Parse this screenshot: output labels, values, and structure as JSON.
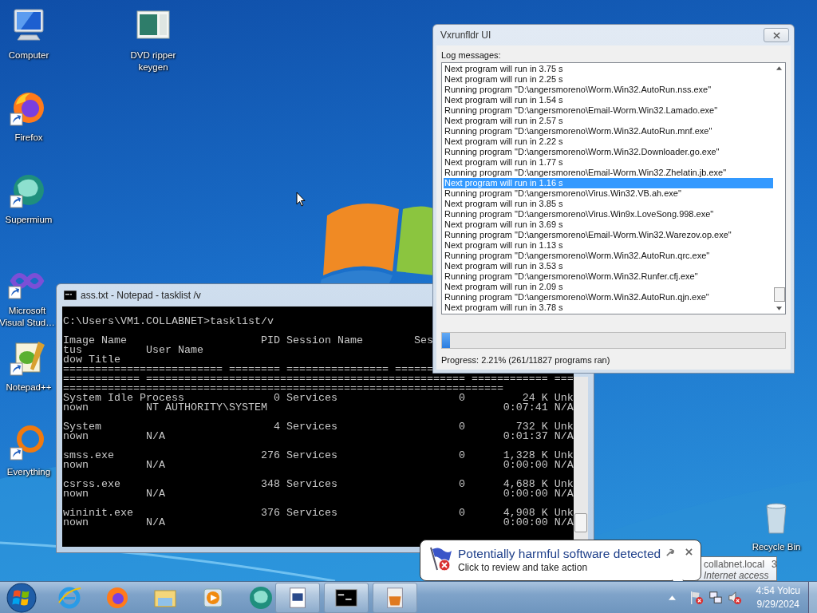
{
  "desktop_icons": [
    {
      "kind": "computer",
      "label": "Computer",
      "shortcut": false
    },
    {
      "kind": "document",
      "label": "DVD ripper keygen",
      "shortcut": false
    },
    {
      "kind": "firefox",
      "label": "Firefox",
      "shortcut": true
    },
    {
      "kind": "supermium",
      "label": "Supermium",
      "shortcut": true
    },
    {
      "kind": "visual-studio",
      "label": "Microsoft Visual Stud…",
      "shortcut": true
    },
    {
      "kind": "notepad",
      "label": "Notepad++",
      "shortcut": true
    },
    {
      "kind": "everything",
      "label": "Everything",
      "shortcut": true
    },
    {
      "kind": "recycle-bin",
      "label": "Recycle Bin",
      "shortcut": false
    }
  ],
  "console_window": {
    "title": "ass.txt - Notepad - tasklist /v",
    "blocks": [
      [
        "C:\\Users\\VM1.COLLABNET>tasklist/v"
      ],
      [
        "Image Name                     PID Session Name        Ses",
        "tus          User Name",
        "dow Title",
        "========================= ======== ================ ======",
        "============ ================================================== ============ ===",
        "=====================================================================",
        "System Idle Process              0 Services                   0         24 K Unk",
        "nown         NT AUTHORITY\\SYSTEM                                     0:07:41 N/A"
      ],
      [
        "System                           4 Services                   0        732 K Unk",
        "nown         N/A                                                     0:01:37 N/A"
      ],
      [
        "smss.exe                       276 Services                   0      1,328 K Unk",
        "nown         N/A                                                     0:00:00 N/A"
      ],
      [
        "csrss.exe                      348 Services                   0      4,688 K Unk",
        "nown         N/A                                                     0:00:00 N/A"
      ],
      [
        "wininit.exe                    376 Services                   0      4,908 K Unk",
        "nown         N/A                                                     0:00:00 N/A"
      ]
    ]
  },
  "vx_window": {
    "title": "Vxrunfldr UI",
    "log_label": "Log messages:",
    "log": [
      {
        "text": "Next program will run in 3.75 s",
        "selected": false
      },
      {
        "text": "Next program will run in 2.25 s",
        "selected": false
      },
      {
        "text": "Running program \"D:\\angersmoreno\\Worm.Win32.AutoRun.nss.exe\"",
        "selected": false
      },
      {
        "text": "Next program will run in 1.54 s",
        "selected": false
      },
      {
        "text": "Running program \"D:\\angersmoreno\\Email-Worm.Win32.Lamado.exe\"",
        "selected": false
      },
      {
        "text": "Next program will run in 2.57 s",
        "selected": false
      },
      {
        "text": "Running program \"D:\\angersmoreno\\Worm.Win32.AutoRun.mnf.exe\"",
        "selected": false
      },
      {
        "text": "Next program will run in 2.22 s",
        "selected": false
      },
      {
        "text": "Running program \"D:\\angersmoreno\\Worm.Win32.Downloader.go.exe\"",
        "selected": false
      },
      {
        "text": "Next program will run in 1.77 s",
        "selected": false
      },
      {
        "text": "Running program \"D:\\angersmoreno\\Email-Worm.Win32.Zhelatin.jb.exe\"",
        "selected": false
      },
      {
        "text": "Next program will run in 1.16 s",
        "selected": true
      },
      {
        "text": "Running program \"D:\\angersmoreno\\Virus.Win32.VB.ah.exe\"",
        "selected": false
      },
      {
        "text": "Next program will run in 3.85 s",
        "selected": false
      },
      {
        "text": "Running program \"D:\\angersmoreno\\Virus.Win9x.LoveSong.998.exe\"",
        "selected": false
      },
      {
        "text": "Next program will run in 3.69 s",
        "selected": false
      },
      {
        "text": "Running program \"D:\\angersmoreno\\Email-Worm.Win32.Warezov.op.exe\"",
        "selected": false
      },
      {
        "text": "Next program will run in 1.13 s",
        "selected": false
      },
      {
        "text": "Running program \"D:\\angersmoreno\\Worm.Win32.AutoRun.qrc.exe\"",
        "selected": false
      },
      {
        "text": "Next program will run in 3.53 s",
        "selected": false
      },
      {
        "text": "Running program \"D:\\angersmoreno\\Worm.Win32.Runfer.cfj.exe\"",
        "selected": false
      },
      {
        "text": "Next program will run in 2.09 s",
        "selected": false
      },
      {
        "text": "Running program \"D:\\angersmoreno\\Worm.Win32.AutoRun.qjn.exe\"",
        "selected": false
      },
      {
        "text": "Next program will run in 3.78 s",
        "selected": false
      }
    ],
    "progress": {
      "level": 0.0221,
      "text": "Progress: 2.21% (261/11827 programs ran)"
    }
  },
  "tooltip": {
    "host": "collabnet.local",
    "count": "3",
    "status": "Internet access"
  },
  "notification": {
    "title": "Potentially harmful software detected",
    "message": "Click to review and take action"
  },
  "taskbar": {
    "pinned": [
      {
        "kind": "browser-e"
      },
      {
        "kind": "firefox"
      },
      {
        "kind": "folder"
      },
      {
        "kind": "media"
      },
      {
        "kind": "supermium"
      }
    ],
    "running": [
      {
        "kind": "app-window"
      },
      {
        "kind": "console"
      },
      {
        "kind": "installer"
      }
    ],
    "tray": [
      {
        "kind": "flag",
        "alert": true
      },
      {
        "kind": "network"
      },
      {
        "kind": "speaker",
        "muted": true
      }
    ],
    "clock": {
      "time": "4:54 Yolcu",
      "date": "9/29/2024"
    }
  }
}
